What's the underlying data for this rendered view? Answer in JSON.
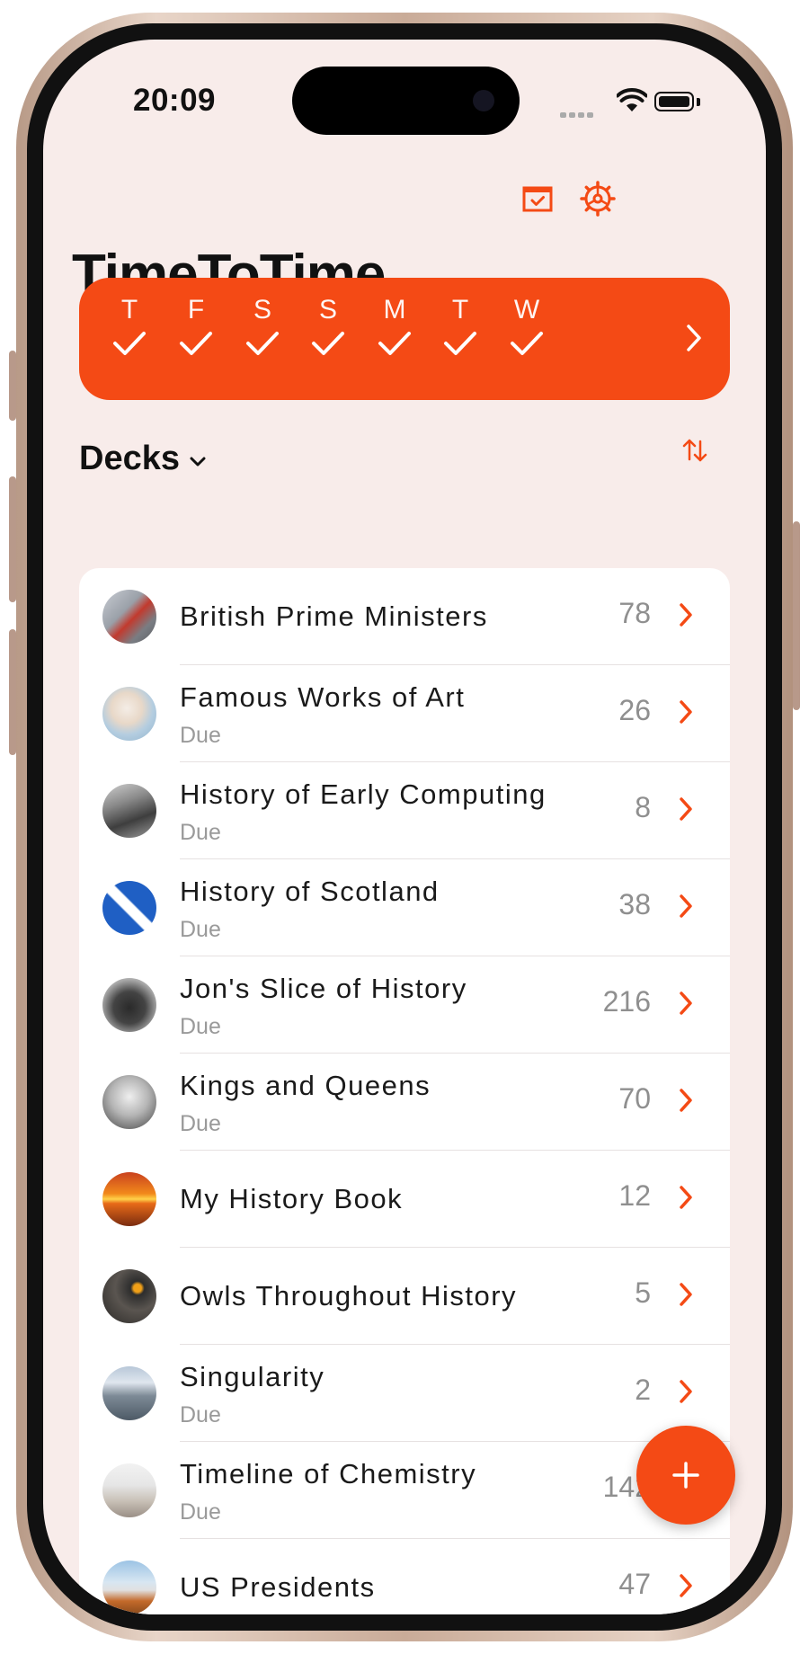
{
  "status_bar": {
    "time": "20:09"
  },
  "app": {
    "title": "TimeToTime"
  },
  "streak": {
    "days": [
      {
        "letter": "T",
        "done": true
      },
      {
        "letter": "F",
        "done": true
      },
      {
        "letter": "S",
        "done": true
      },
      {
        "letter": "S",
        "done": true
      },
      {
        "letter": "M",
        "done": true
      },
      {
        "letter": "T",
        "done": true
      },
      {
        "letter": "W",
        "done": true
      }
    ],
    "next_icon": "chevron-right-icon"
  },
  "toolbar": {
    "calendar_icon": "calendar-check-icon",
    "settings_icon": "gear-icon"
  },
  "decks": {
    "header": "Decks",
    "sort_icon": "sort-arrows-icon",
    "items": [
      {
        "name": "British Prime Ministers",
        "due": "",
        "count": "78"
      },
      {
        "name": "Famous Works of Art",
        "due": "Due",
        "count": "26"
      },
      {
        "name": "History of Early Computing",
        "due": "Due",
        "count": "8"
      },
      {
        "name": "History of Scotland",
        "due": "Due",
        "count": "38"
      },
      {
        "name": "Jon's Slice of History",
        "due": "Due",
        "count": "216"
      },
      {
        "name": "Kings and Queens",
        "due": "Due",
        "count": "70"
      },
      {
        "name": "My History Book",
        "due": "",
        "count": "12"
      },
      {
        "name": "Owls Throughout History",
        "due": "",
        "count": "5"
      },
      {
        "name": "Singularity",
        "due": "Due",
        "count": "2"
      },
      {
        "name": "Timeline of Chemistry",
        "due": "Due",
        "count": "142"
      },
      {
        "name": "US Presidents",
        "due": "",
        "count": "47"
      }
    ]
  },
  "fab": {
    "icon": "plus-icon"
  },
  "colors": {
    "accent": "#f44a15",
    "background": "#f8ecea"
  }
}
